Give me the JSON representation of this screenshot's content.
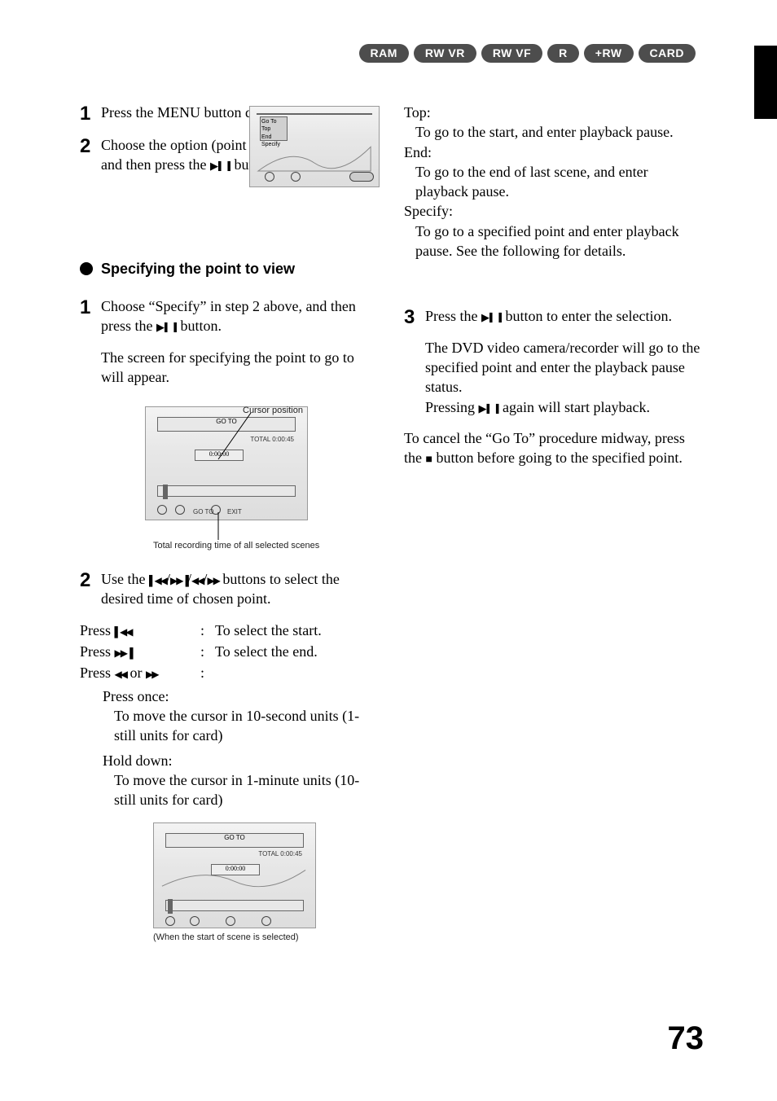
{
  "badges": [
    "RAM",
    "RW VR",
    "RW VF",
    "R",
    "+RW",
    "CARD"
  ],
  "left": {
    "step1_pre": "Press the MENU button during playback.",
    "step2_pre": "Choose the option (point you want to go to), and then press the ",
    "step2_post": " button.",
    "section_title": "Specifying the point to view",
    "spec_step1_a": "Choose “Specify” in step 2 above, and then press the ",
    "spec_step1_b": " button.",
    "spec_step1_c": "The screen for specifying the point to go to will appear.",
    "spec_step2_a": "Use the ",
    "spec_step2_b": " buttons to select the desired time of chosen point.",
    "press": {
      "a_label": "Press ",
      "b_label": "Press ",
      "c_label": "Press ",
      "or": " or ",
      "a_desc": "To select the start.",
      "b_desc": "To select the end."
    },
    "press_once": "Press once:",
    "press_once_desc": "To move the cursor in 10-second units (1-still units for card)",
    "hold_down": "Hold down:",
    "hold_down_desc": "To move the cursor in 1-minute units (10-still units for card)",
    "fig1": {
      "callout1": "Cursor position",
      "callout2": "Total recording time of all selected scenes",
      "heading": "GO TO",
      "time_box": "0:00:00",
      "total": "TOTAL 0:00:45",
      "label_goto": "GO TO",
      "label_exit": "EXIT"
    },
    "fig2": {
      "heading": "GO TO",
      "time_box": "0:00:00",
      "total": "TOTAL 0:00:45",
      "caption": "(When the start of scene is selected)"
    },
    "fig_menu": {
      "t1": "Go To",
      "items": [
        "Top",
        "End",
        "Specify"
      ]
    }
  },
  "right": {
    "top": "Top:",
    "top_def": "To go to the start, and enter playback pause.",
    "end": "End:",
    "end_def": "To go to the end of last scene, and enter playback pause.",
    "specify": "Specify:",
    "specify_def": "To go to a specified point and enter playback pause. See the following for details.",
    "spec_step3_a": "Press the ",
    "spec_step3_b": " button to enter the selection.",
    "spec_step3_c": "The DVD video camera/recorder will go to the specified point and enter the playback pause status.",
    "spec_step3_d1": "Pressing ",
    "spec_step3_d2": " again will start playback.",
    "cancel_a": "To cancel the “Go To” procedure midway, press the ",
    "cancel_b": " button before going to the specified point."
  },
  "page_number": "73"
}
